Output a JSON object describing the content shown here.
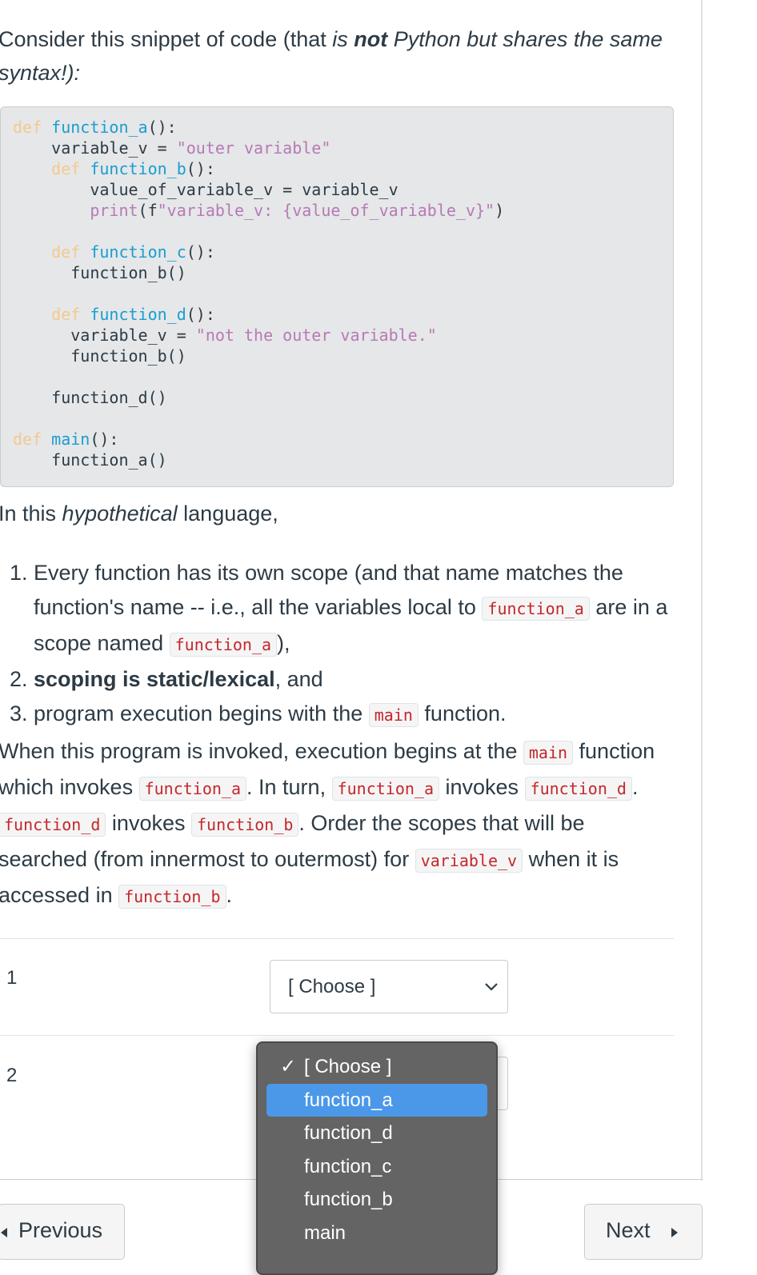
{
  "intro": {
    "t1": "Consider this snippet of code (that ",
    "t2": "is ",
    "t3": "not",
    "t4": " Python but shares the same syntax!):"
  },
  "code": {
    "l1_kw": "def",
    "l1_fn": "function_a",
    "l1_rest": "():",
    "l2_a": "    variable_v = ",
    "l2_str": "\"outer variable\"",
    "l3_kw": "    def",
    "l3_fn": "function_b",
    "l3_rest": "():",
    "l4": "        value_of_variable_v = variable_v",
    "l5_indent": "        ",
    "l5_bi": "print",
    "l5_a": "(f",
    "l5_str": "\"variable_v: {value_of_variable_v}\"",
    "l5_b": ")",
    "l7_kw": "    def",
    "l7_fn": "function_c",
    "l7_rest": "():",
    "l8": "      function_b()",
    "l10_kw": "    def",
    "l10_fn": "function_d",
    "l10_rest": "():",
    "l11_a": "      variable_v = ",
    "l11_str": "\"not the outer variable.\"",
    "l12": "      function_b()",
    "l14": "    function_d()",
    "l16_kw": "def",
    "l16_fn": "main",
    "l16_rest": "():",
    "l17": "    function_a()"
  },
  "lang": {
    "t1": "In this ",
    "t2": "hypothetical",
    "t3": " language,"
  },
  "list": {
    "n1": "1.",
    "i1_a": "Every function has its own scope (and that name matches the function's name -- i.e., all the variables local to ",
    "i1_code1": "function_a",
    "i1_b": " are in a scope named ",
    "i1_code2": "function_a",
    "i1_c": "),",
    "n2": "2.",
    "i2_bold": "scoping is static/lexical",
    "i2_rest": ", and",
    "n3": "3.",
    "i3_a": "program execution begins with the ",
    "i3_code": "main",
    "i3_b": " function."
  },
  "desc": {
    "t1": "When this program is invoked, execution begins at the ",
    "c1": "main",
    "t2": " function which invokes ",
    "c2": "function_a",
    "t3": ". In turn, ",
    "c3": "function_a",
    "t4": " invokes ",
    "c4": "function_d",
    "t5": ". ",
    "c5": "function_d",
    "t6": " invokes ",
    "c6": "function_b",
    "t7": ". Order the scopes that will be searched (from innermost to outermost) for ",
    "c7": "variable_v",
    "t8": " when it is accessed in ",
    "c8": "function_b",
    "t9": "."
  },
  "answers": {
    "row1_label": "1",
    "row1_value": "[ Choose ]",
    "row2_label": "2"
  },
  "dropdown": {
    "check": "✓",
    "options": [
      "[ Choose ]",
      "function_a",
      "function_d",
      "function_c",
      "function_b",
      "main"
    ],
    "selected": "[ Choose ]",
    "highlighted": "function_a"
  },
  "nav": {
    "previous": "Previous",
    "next": "Next"
  }
}
